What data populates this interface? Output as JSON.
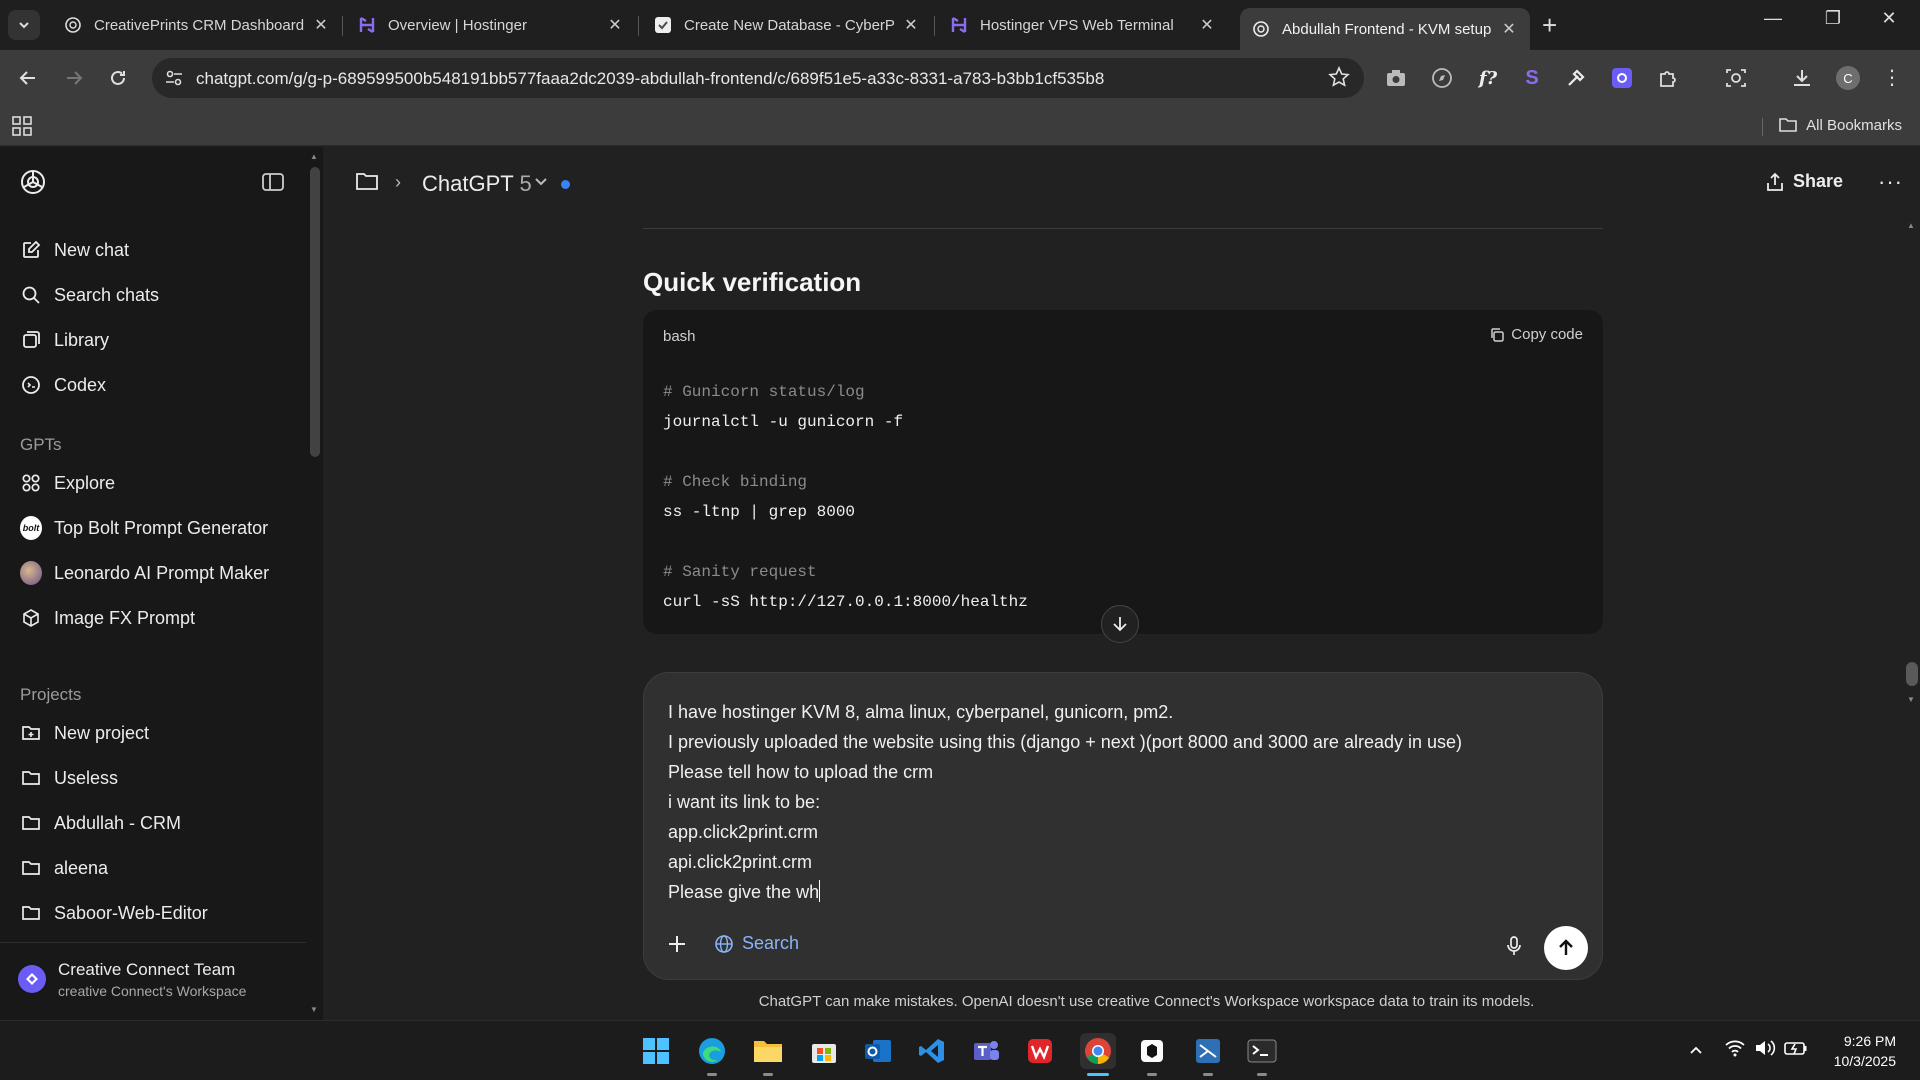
{
  "browser": {
    "tabs": [
      {
        "title": "CreativePrints CRM Dashboard",
        "icon": "chatgpt-icon",
        "active": false
      },
      {
        "title": "Overview | Hostinger",
        "icon": "hostinger-icon",
        "active": false
      },
      {
        "title": "Create New Database - CyberPa",
        "icon": "cyberpanel-icon",
        "active": false
      },
      {
        "title": "Hostinger VPS Web Terminal",
        "icon": "hostinger-icon",
        "active": false
      },
      {
        "title": "Abdullah Frontend - KVM setup",
        "icon": "chatgpt-icon",
        "active": true
      }
    ],
    "url": "chatgpt.com/g/g-p-689599500b548191bb577faaa2dc2039-abdullah-frontend/c/689f51e5-a33c-8331-a783-b3bb1cf535b8",
    "profile_initial": "C",
    "bookmarks_label": "All Bookmarks"
  },
  "sidebar": {
    "primary": [
      {
        "label": "New chat",
        "icon": "edit-icon"
      },
      {
        "label": "Search chats",
        "icon": "search-icon"
      },
      {
        "label": "Library",
        "icon": "library-icon"
      },
      {
        "label": "Codex",
        "icon": "codex-icon"
      }
    ],
    "gpts_heading": "GPTs",
    "gpts": [
      {
        "label": "Explore",
        "icon": "grid-icon"
      },
      {
        "label": "Top Bolt Prompt Generator",
        "icon": "bolt-icon"
      },
      {
        "label": "Leonardo AI Prompt Maker",
        "icon": "leonardo-icon"
      },
      {
        "label": "Image FX Prompt",
        "icon": "cube-icon"
      }
    ],
    "projects_heading": "Projects",
    "projects": [
      {
        "label": "New project",
        "icon": "new-folder-icon"
      },
      {
        "label": "Useless",
        "icon": "folder-icon"
      },
      {
        "label": "Abdullah - CRM",
        "icon": "folder-icon"
      },
      {
        "label": "aleena",
        "icon": "folder-icon"
      },
      {
        "label": "Saboor-Web-Editor",
        "icon": "folder-icon"
      }
    ],
    "workspace": {
      "name": "Creative Connect Team",
      "subtitle": "creative Connect's Workspace"
    }
  },
  "header": {
    "model": "ChatGPT",
    "version": "5",
    "share_label": "Share"
  },
  "content": {
    "section_title": "Quick verification",
    "code": {
      "language": "bash",
      "copy_label": "Copy code",
      "lines": [
        {
          "text": "# Gunicorn status/log",
          "comment": true
        },
        {
          "text": "journalctl -u gunicorn -f",
          "comment": false
        },
        {
          "text": "",
          "comment": false
        },
        {
          "text": "# Check binding",
          "comment": true
        },
        {
          "text": "ss -ltnp | grep 8000",
          "comment": false
        },
        {
          "text": "",
          "comment": false
        },
        {
          "text": "# Sanity request",
          "comment": true
        },
        {
          "text": "curl -sS http://127.0.0.1:8000/healthz",
          "comment": false
        }
      ]
    }
  },
  "composer": {
    "lines": [
      "I have hostinger KVM 8, alma linux, cyberpanel, gunicorn, pm2.",
      "I previously uploaded the website using this (django + next )(port 8000 and 3000 are already in use)",
      "Please tell how to upload the crm",
      "i want its link to be:",
      "app.click2print.crm",
      "api.click2print.crm",
      "Please give the wh"
    ],
    "search_label": "Search"
  },
  "disclaimer": "ChatGPT can make mistakes. OpenAI doesn't use creative Connect's Workspace workspace data to train its models.",
  "taskbar": {
    "time": "9:26 PM",
    "date": "10/3/2025",
    "apps": [
      "windows-start-icon",
      "edge-icon",
      "file-explorer-icon",
      "store-icon",
      "outlook-icon",
      "vscode-icon",
      "teams-icon",
      "wps-icon",
      "chrome-icon",
      "app-icon",
      "remote-icon",
      "terminal-icon"
    ]
  },
  "colors": {
    "accent": "#3b82f6",
    "background": "#212121",
    "sidebar": "#181818",
    "code_bg": "#171717",
    "composer_bg": "#303030"
  }
}
